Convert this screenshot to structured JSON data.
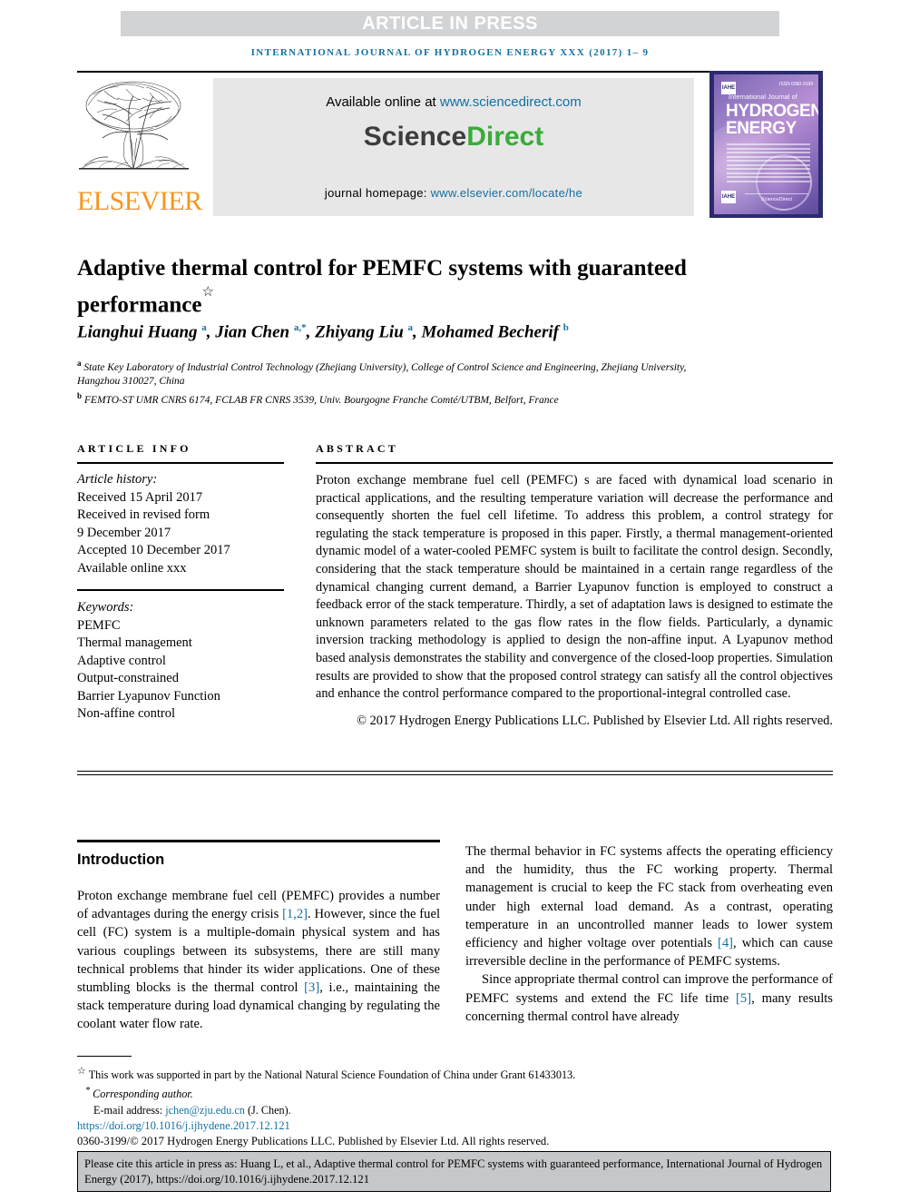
{
  "banner": {
    "label": "ARTICLE IN PRESS"
  },
  "running_head": "INTERNATIONAL JOURNAL OF HYDROGEN ENERGY XXX (2017) 1– 9",
  "masthead": {
    "available_prefix": "Available online at ",
    "available_url": "www.sciencedirect.com",
    "wordmark_science": "Science",
    "wordmark_direct": "Direct",
    "homepage_prefix": "journal homepage: ",
    "homepage_url": "www.elsevier.com/locate/he",
    "publisher": "ELSEVIER"
  },
  "cover": {
    "small_title": "International Journal of",
    "line1": "HYDROGEN",
    "line2": "ENERGY",
    "issn": "ISSN 0360-3199",
    "badge_top": "IAHE",
    "badge_bottom": "IAHE",
    "footer": "ScienceDirect"
  },
  "article": {
    "title": "Adaptive thermal control for PEMFC systems with guaranteed performance",
    "title_symbol": "☆",
    "authors_html": "Lianghui Huang <sup>a</sup>, Jian Chen <sup>a,*</sup>, Zhiyang Liu <sup>a</sup>, Mohamed Becherif <sup>b</sup>",
    "affiliation_a": "State Key Laboratory of Industrial Control Technology (Zhejiang University), College of Control Science and Engineering, Zhejiang University, Hangzhou 310027, China",
    "affiliation_b": "FEMTO-ST UMR CNRS 6174, FCLAB FR CNRS 3539, Univ. Bourgogne Franche Comté/UTBM, Belfort, France"
  },
  "article_info": {
    "heading": "ARTICLE INFO",
    "history_label": "Article history:",
    "history": [
      "Received 15 April 2017",
      "Received in revised form",
      "9 December 2017",
      "Accepted 10 December 2017",
      "Available online xxx"
    ],
    "keywords_label": "Keywords:",
    "keywords": [
      "PEMFC",
      "Thermal management",
      "Adaptive control",
      "Output-constrained",
      "Barrier Lyapunov Function",
      "Non-affine control"
    ]
  },
  "abstract": {
    "heading": "ABSTRACT",
    "body": "Proton exchange membrane fuel cell (PEMFC) s are faced with dynamical load scenario in practical applications, and the resulting temperature variation will decrease the performance and consequently shorten the fuel cell lifetime. To address this problem, a control strategy for regulating the stack temperature is proposed in this paper. Firstly, a thermal management-oriented dynamic model of a water-cooled PEMFC system is built to facilitate the control design. Secondly, considering that the stack temperature should be maintained in a certain range regardless of the dynamical changing current demand, a Barrier Lyapunov function is employed to construct a feedback error of the stack temperature. Thirdly, a set of adaptation laws is designed to estimate the unknown parameters related to the gas flow rates in the flow fields. Particularly, a dynamic inversion tracking methodology is applied to design the non-affine input. A Lyapunov method based analysis demonstrates the stability and convergence of the closed-loop properties. Simulation results are provided to show that the proposed control strategy can satisfy all the control objectives and enhance the control performance compared to the proportional-integral controlled case.",
    "copyright": "© 2017 Hydrogen Energy Publications LLC. Published by Elsevier Ltd. All rights reserved."
  },
  "introduction": {
    "heading": "Introduction",
    "left_paragraph_html": "Proton exchange membrane fuel cell (PEMFC) provides a number of advantages during the energy crisis <span class=\"ref\">[1,2]</span>. However, since the fuel cell (FC) system is a multiple-domain physical system and has various couplings between its subsystems, there are still many technical problems that hinder its wider applications. One of these stumbling blocks is the thermal control <span class=\"ref\">[3]</span>, i.e., maintaining the stack temperature during load dynamical changing by regulating the coolant water flow rate.",
    "right_paragraph_1_html": "The thermal behavior in FC systems affects the operating efficiency and the humidity, thus the FC working property. Thermal management is crucial to keep the FC stack from overheating even under high external load demand. As a contrast, operating temperature in an uncontrolled manner leads to lower system efficiency and higher voltage over potentials <span class=\"ref\">[4]</span>, which can cause irreversible decline in the performance of PEMFC systems.",
    "right_paragraph_2_html": "Since appropriate thermal control can improve the performance of PEMFC systems and extend the FC life time <span class=\"ref\">[5]</span>, many results concerning thermal control have already"
  },
  "footnotes": {
    "funding": "This work was supported in part by the National Natural Science Foundation of China under Grant 61433013.",
    "funding_marker": "☆",
    "corresponding": "Corresponding author.",
    "corresponding_marker": "*",
    "email_label": "E-mail address: ",
    "email": "jchen@zju.edu.cn",
    "email_suffix": " (J. Chen).",
    "doi": "https://doi.org/10.1016/j.ijhydene.2017.12.121",
    "issn_line": "0360-3199/© 2017 Hydrogen Energy Publications LLC. Published by Elsevier Ltd. All rights reserved."
  },
  "cite_box": {
    "text": "Please cite this article in press as: Huang L, et al., Adaptive thermal control for PEMFC systems with guaranteed performance, International Journal of Hydrogen Energy (2017), https://doi.org/10.1016/j.ijhydene.2017.12.121"
  }
}
